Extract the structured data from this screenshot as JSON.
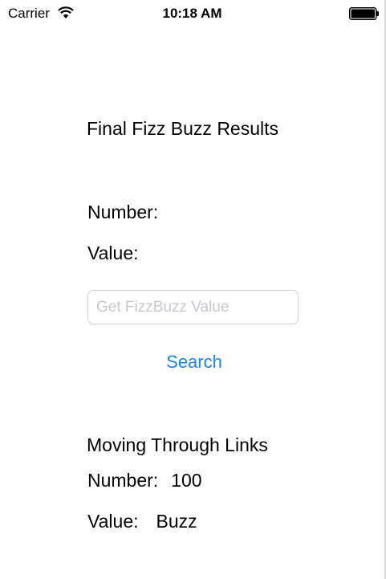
{
  "status_bar": {
    "carrier": "Carrier",
    "time": "10:18 AM",
    "wifi_icon": "wifi-icon",
    "battery_icon": "battery-icon"
  },
  "results": {
    "heading": "Final Fizz Buzz Results",
    "number_label": "Number:",
    "number_value": "",
    "value_label": "Value:",
    "value_value": ""
  },
  "search": {
    "placeholder": "Get FizzBuzz Value",
    "value": "",
    "button_label": "Search",
    "button_color": "#1a82f6"
  },
  "links": {
    "title": "Moving Through Links",
    "number_label": "Number:",
    "number_value": "100",
    "value_label": "Value:",
    "value_value": "Buzz"
  }
}
